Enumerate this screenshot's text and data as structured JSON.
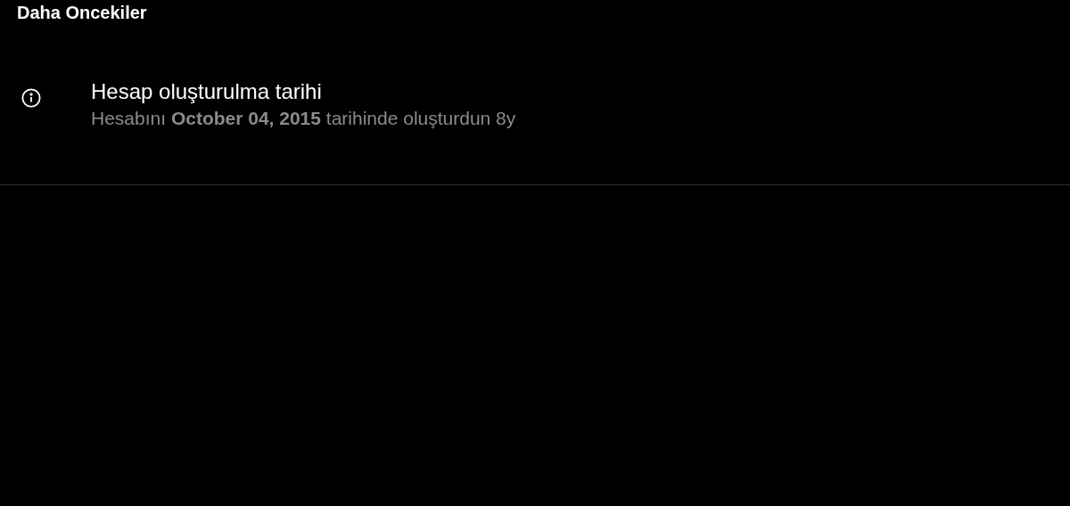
{
  "section_title": "Daha Oncekiler",
  "items": [
    {
      "title": "Hesap oluşturulma tarihi",
      "description": "Hesabını **October 04, 2015** tarihinde oluşturdun 8y"
    }
  ]
}
